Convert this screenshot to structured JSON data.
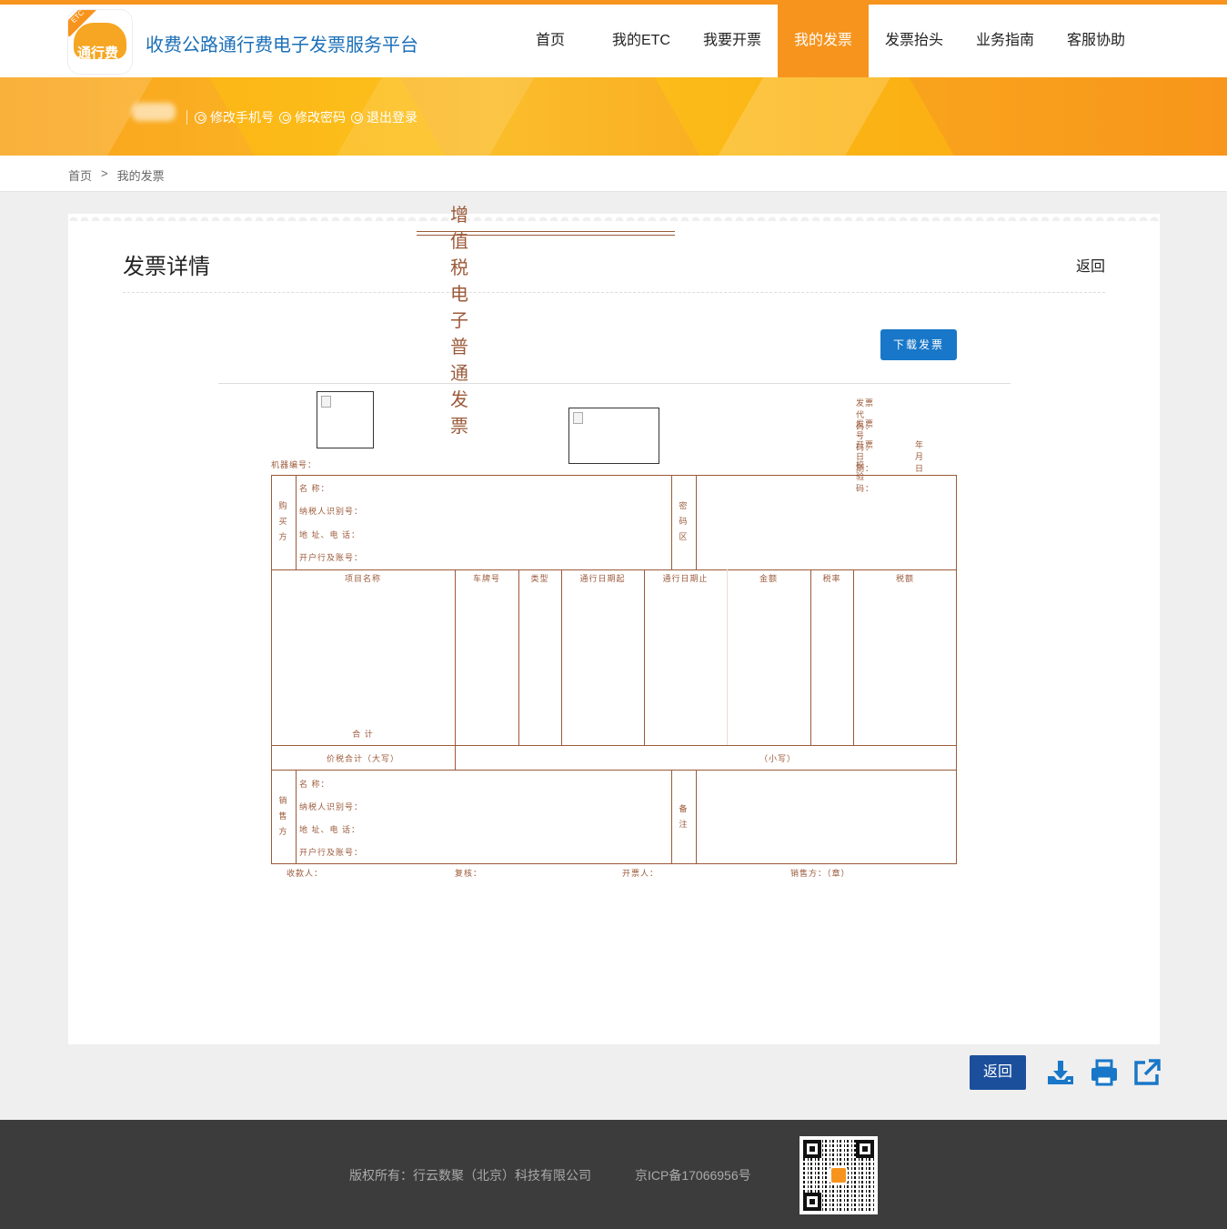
{
  "header": {
    "logo_text": "通行费",
    "logo_tag": "ETC",
    "site_title": "收费公路通行费电子发票服务平台",
    "nav": [
      {
        "label": "首页",
        "active": false
      },
      {
        "label": "我的ETC",
        "active": false
      },
      {
        "label": "我要开票",
        "active": false
      },
      {
        "label": "我的发票",
        "active": true
      },
      {
        "label": "发票抬头",
        "active": false
      },
      {
        "label": "业务指南",
        "active": false
      },
      {
        "label": "客服协助",
        "active": false
      }
    ],
    "accent_color": "#f7941d"
  },
  "user_bar": {
    "change_phone": "修改手机号",
    "change_password": "修改密码",
    "logout": "退出登录"
  },
  "breadcrumb": {
    "home": "首页",
    "separator": ">",
    "current": "我的发票"
  },
  "detail": {
    "title": "发票详情",
    "back_link": "返回",
    "download_button": "下载发票"
  },
  "invoice": {
    "title": "增值税电子普通发票",
    "code_label": "发票代码：",
    "number_label": "发票号码：",
    "date_label": "开票日期：",
    "date_units": "年    月    日",
    "check_label": "校 验 码：",
    "machine_label": "机器编号：",
    "buyer_side": "购买方",
    "buyer_name": "名          称：",
    "buyer_tax_id": "纳税人识别号：",
    "buyer_address": "地 址、电 话：",
    "buyer_bank": "开户行及账号：",
    "cipher_area": "密码区",
    "columns": [
      "项目名称",
      "车牌号",
      "类型",
      "通行日期起",
      "通行日期止",
      "金额",
      "税率",
      "税额"
    ],
    "total_label": "合          计",
    "total_in_words": "价税合计（大写）",
    "small_amount": "（小写）",
    "seller_side": "销售方",
    "seller_name": "名          称：",
    "seller_tax_id": "纳税人识别号：",
    "seller_address": "地 址、电 话：",
    "seller_bank": "开户行及账号：",
    "remarks": "备注",
    "payee": "收款人：",
    "reviewer": "复核：",
    "issuer": "开票人：",
    "seller_seal": "销售方：（章）",
    "text_color": "#9b5a3a"
  },
  "actions": {
    "back": "返回",
    "download_icon": "download-icon",
    "print_icon": "print-icon",
    "open_icon": "external-link-icon",
    "icon_color": "#1877c8"
  },
  "footer": {
    "copyright": "版权所有：行云数聚（北京）科技有限公司",
    "icp": "京ICP备17066956号"
  }
}
